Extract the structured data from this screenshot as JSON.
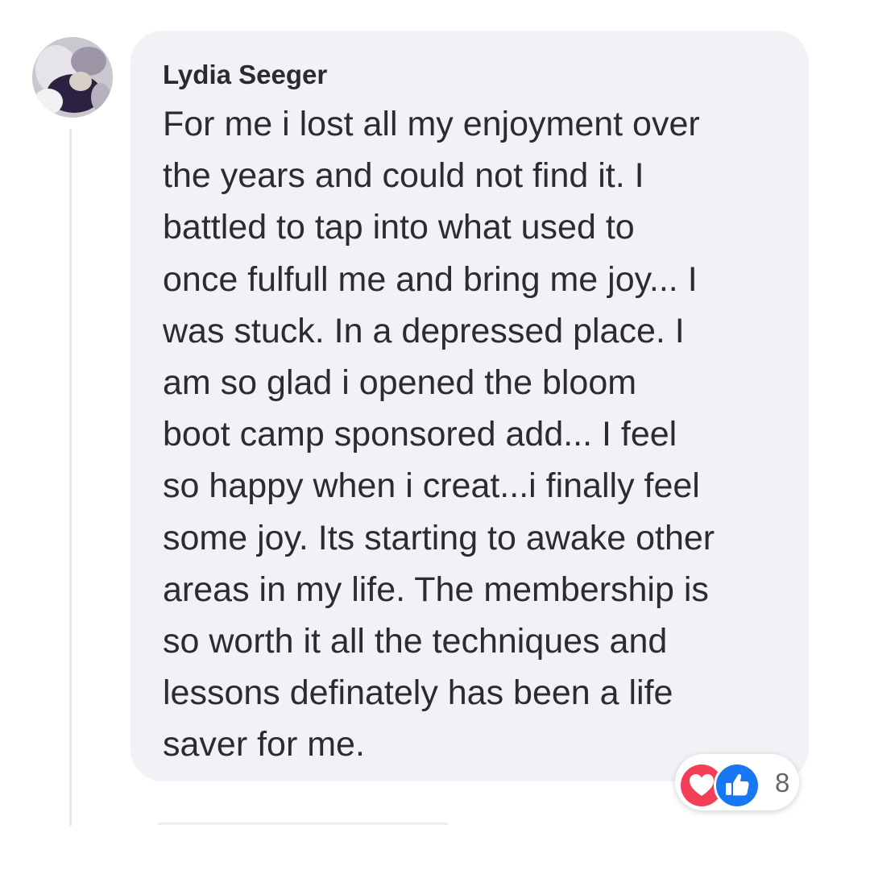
{
  "comment": {
    "author": "Lydia Seeger",
    "text": "For me i lost all my enjoyment over\nthe years and could not find it. I\nbattled to tap into what used to\nonce fulfull me and bring me joy... I\nwas stuck. In a depressed place. I\nam so glad i opened the bloom\nboot camp sponsored add... I feel\nso happy when i creat...i finally feel\nsome joy. Its starting to awake other\nareas in my life. The membership is\nso worth it all the techniques and\nlessons definately has been a life\nsaver for me."
  },
  "reactions": {
    "types": [
      "love",
      "like"
    ],
    "count": "8"
  },
  "colors": {
    "bubble": "#f0f2f5",
    "love": "#f33e58",
    "like": "#1877f2",
    "text": "#2b2c2f"
  },
  "icons": {
    "avatar": "profile-photo",
    "love": "heart-icon",
    "like": "thumbs-up-icon"
  }
}
